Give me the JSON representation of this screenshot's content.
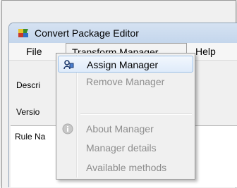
{
  "window": {
    "title": "Convert Package Editor",
    "icon": "app-package-icon"
  },
  "menubar": {
    "file": "File",
    "transform_manager": "Transform Manager",
    "help": "Help"
  },
  "background_labels": {
    "description": "Descri",
    "version": "Versio",
    "rule_name": "Rule Na"
  },
  "dropdown": {
    "items": [
      {
        "label": "Assign Manager",
        "enabled": true,
        "highlighted": true,
        "icon": "assign-manager-icon"
      },
      {
        "label": "Remove Manager",
        "enabled": false
      },
      {
        "label": "About Manager",
        "enabled": false,
        "icon": "info-icon"
      },
      {
        "label": "Manager details",
        "enabled": false
      },
      {
        "label": "Available methods",
        "enabled": false
      }
    ]
  },
  "colors": {
    "titlebar": "#c9daef",
    "highlight_border": "#99bfe8",
    "disabled_text": "#8d8d8d"
  }
}
